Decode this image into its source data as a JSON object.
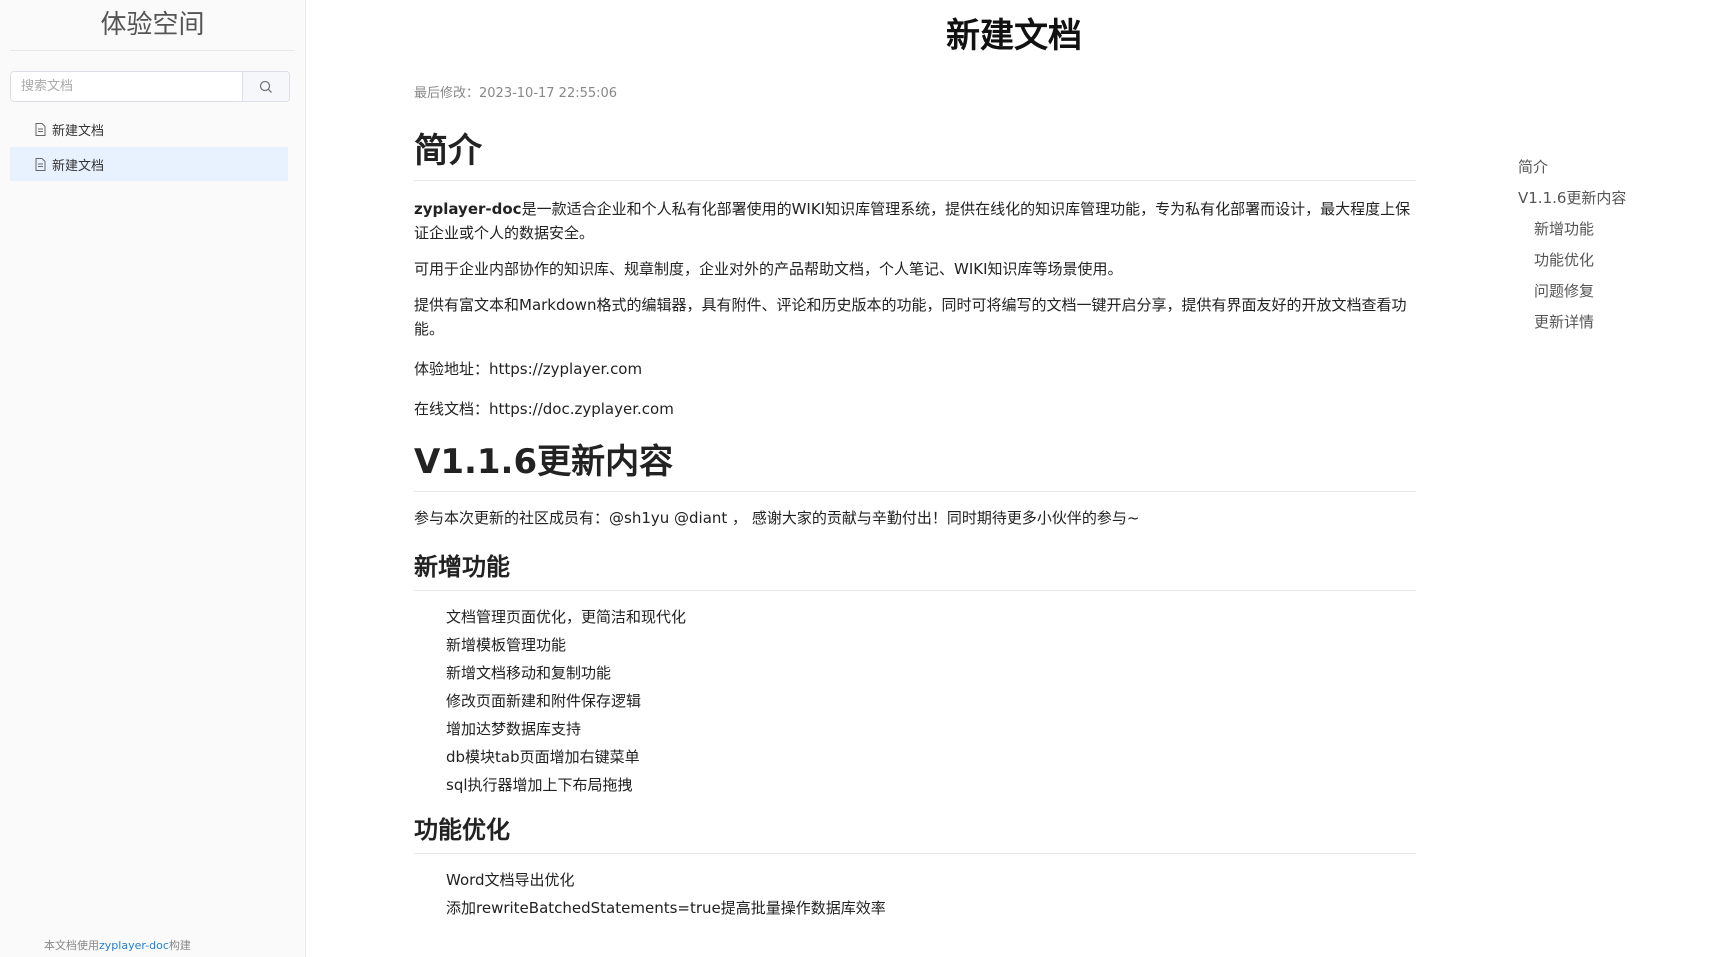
{
  "sidebar": {
    "space_title": "体验空间",
    "search_placeholder": "搜索文档",
    "docs": [
      {
        "label": "新建文档"
      },
      {
        "label": "新建文档"
      }
    ],
    "footer_prefix": "本文档使用",
    "footer_brand": "zyplayer-doc",
    "footer_suffix": "构建"
  },
  "doc": {
    "title": "新建文档",
    "modified": "最后修改：2023-10-17 22:55:06",
    "intro_heading": "简介",
    "intro_p1_bold": "zyplayer-doc",
    "intro_p1_rest": "是一款适合企业和个人私有化部署使用的WIKI知识库管理系统，提供在线化的知识库管理功能，专为私有化部署而设计，最大程度上保证企业或个人的数据安全。",
    "intro_p2": "可用于企业内部协作的知识库、规章制度，企业对外的产品帮助文档，个人笔记、WIKI知识库等场景使用。",
    "intro_p3": "提供有富文本和Markdown格式的编辑器，具有附件、评论和历史版本的功能，同时可将编写的文档一键开启分享，提供有界面友好的开放文档查看功能。",
    "intro_p4": "体验地址：https://zyplayer.com",
    "intro_p5": "在线文档：https://doc.zyplayer.com",
    "update_heading": "V1.1.6更新内容",
    "update_p1": "参与本次更新的社区成员有：@sh1yu @diant ， 感谢大家的贡献与辛勤付出！同时期待更多小伙伴的参与~",
    "new_features_heading": "新增功能",
    "new_features": [
      "文档管理页面优化，更简洁和现代化",
      "新增模板管理功能",
      "新增文档移动和复制功能",
      "修改页面新建和附件保存逻辑",
      "增加达梦数据库支持",
      "db模块tab页面增加右键菜单",
      "sql执行器增加上下布局拖拽"
    ],
    "optimize_heading": "功能优化",
    "optimizations": [
      "Word文档导出优化",
      "添加rewriteBatchedStatements=true提高批量操作数据库效率"
    ]
  },
  "toc": [
    {
      "label": "简介",
      "level": 1
    },
    {
      "label": "V1.1.6更新内容",
      "level": 1
    },
    {
      "label": "新增功能",
      "level": 2
    },
    {
      "label": "功能优化",
      "level": 2
    },
    {
      "label": "问题修复",
      "level": 2
    },
    {
      "label": "更新详情",
      "level": 2
    }
  ],
  "colors": {
    "active_item_bg": "#e8f2fe",
    "brand_link": "#1e7fd8"
  }
}
